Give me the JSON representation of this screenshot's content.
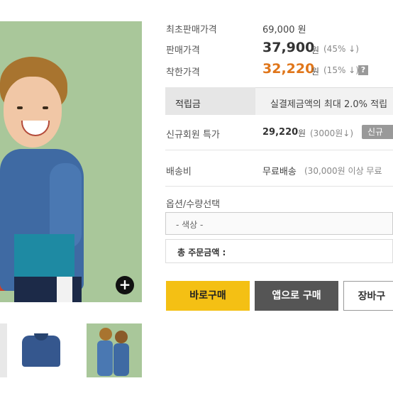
{
  "product": {
    "rows": {
      "initial_price": {
        "label": "최초판매가격",
        "value": "69,000 원"
      },
      "sale_price": {
        "label": "판매가격",
        "value": "37,900",
        "unit": "원",
        "discount": "(45% ↓)"
      },
      "good_price": {
        "label": "착한가격",
        "value": "32,220",
        "unit": "원",
        "discount": "(15% ↓)",
        "help": "?"
      },
      "points": {
        "label": "적립금",
        "value": "실결제금액의 최대 2.0% 적립"
      },
      "new_member": {
        "label": "신규회원 특가",
        "value": "29,220",
        "unit": "원",
        "discount": "(3000원↓)",
        "badge": "신규"
      },
      "shipping": {
        "label": "배송비",
        "value": "무료배송",
        "note": "(30,000원 이상 무료"
      }
    },
    "options": {
      "title": "옵션/수량선택",
      "color_select": "- 색상 -",
      "total_label": "총 주문금액 :"
    },
    "buttons": {
      "buy_now": "바로구매",
      "app_buy": "앱으로 구매",
      "cart": "장바구"
    },
    "zoom": "+",
    "colors": {
      "sale": "#e0761a",
      "buy_button": "#f4c014",
      "app_button": "#555555"
    }
  }
}
